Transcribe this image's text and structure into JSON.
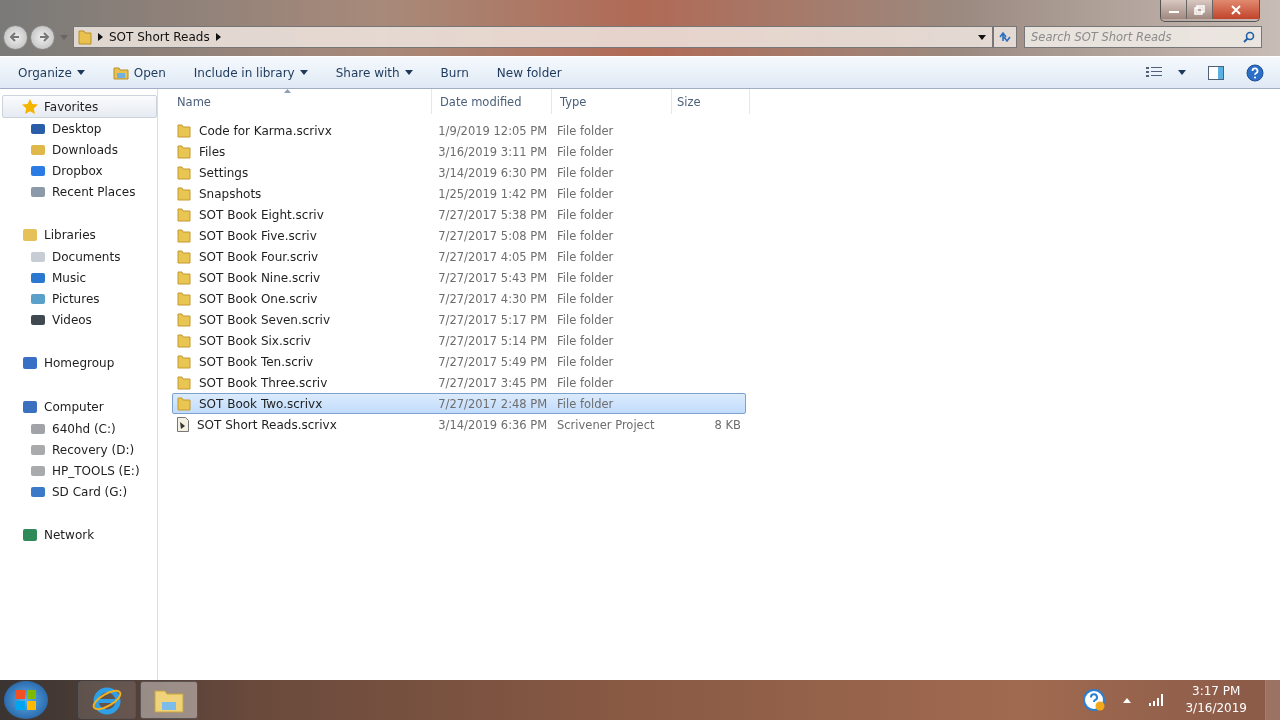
{
  "address": {
    "crumbs": [
      "SOT Short Reads"
    ]
  },
  "search": {
    "placeholder": "Search SOT Short Reads"
  },
  "toolbar": [
    {
      "label": "Organize",
      "dropdown": true,
      "icon": false
    },
    {
      "label": "Open",
      "dropdown": false,
      "icon": true
    },
    {
      "label": "Include in library",
      "dropdown": true,
      "icon": false
    },
    {
      "label": "Share with",
      "dropdown": true,
      "icon": false
    },
    {
      "label": "Burn",
      "dropdown": false,
      "icon": false
    },
    {
      "label": "New folder",
      "dropdown": false,
      "icon": false
    }
  ],
  "sidebar": {
    "groups": [
      {
        "label": "Favorites",
        "kind": "star",
        "selected": true,
        "children": [
          {
            "label": "Desktop",
            "kind": "desktop"
          },
          {
            "label": "Downloads",
            "kind": "downloads"
          },
          {
            "label": "Dropbox",
            "kind": "dropbox"
          },
          {
            "label": "Recent Places",
            "kind": "recent"
          }
        ]
      },
      {
        "label": "Libraries",
        "kind": "library",
        "selected": false,
        "children": [
          {
            "label": "Documents",
            "kind": "document"
          },
          {
            "label": "Music",
            "kind": "music"
          },
          {
            "label": "Pictures",
            "kind": "picture"
          },
          {
            "label": "Videos",
            "kind": "video"
          }
        ]
      },
      {
        "label": "Homegroup",
        "kind": "homegroup",
        "selected": false
      },
      {
        "label": "Computer",
        "kind": "computer",
        "selected": false,
        "children": [
          {
            "label": "640hd (C:)",
            "kind": "system-drive"
          },
          {
            "label": "Recovery (D:)",
            "kind": "drive"
          },
          {
            "label": "HP_TOOLS (E:)",
            "kind": "drive"
          },
          {
            "label": "SD Card (G:)",
            "kind": "sd"
          }
        ]
      },
      {
        "label": "Network",
        "kind": "network",
        "selected": false
      }
    ]
  },
  "table": {
    "columns": [
      "Name",
      "Date modified",
      "Type",
      "Size"
    ],
    "rows": [
      {
        "name": "Code for Karma.scrivx",
        "date": "1/9/2019 12:05 PM",
        "type": "File folder",
        "kind": "folder",
        "selected": false
      },
      {
        "name": "Files",
        "date": "3/16/2019 3:11 PM",
        "type": "File folder",
        "kind": "folder",
        "selected": false
      },
      {
        "name": "Settings",
        "date": "3/14/2019 6:30 PM",
        "type": "File folder",
        "kind": "folder",
        "selected": false
      },
      {
        "name": "Snapshots",
        "date": "1/25/2019 1:42 PM",
        "type": "File folder",
        "kind": "folder",
        "selected": false
      },
      {
        "name": "SOT Book Eight.scriv",
        "date": "7/27/2017 5:38 PM",
        "type": "File folder",
        "kind": "folder",
        "selected": false
      },
      {
        "name": "SOT Book Five.scriv",
        "date": "7/27/2017 5:08 PM",
        "type": "File folder",
        "kind": "folder",
        "selected": false
      },
      {
        "name": "SOT Book Four.scriv",
        "date": "7/27/2017 4:05 PM",
        "type": "File folder",
        "kind": "folder",
        "selected": false
      },
      {
        "name": "SOT Book Nine.scriv",
        "date": "7/27/2017 5:43 PM",
        "type": "File folder",
        "kind": "folder",
        "selected": false
      },
      {
        "name": "SOT Book One.scriv",
        "date": "7/27/2017 4:30 PM",
        "type": "File folder",
        "kind": "folder",
        "selected": false
      },
      {
        "name": "SOT Book Seven.scriv",
        "date": "7/27/2017 5:17 PM",
        "type": "File folder",
        "kind": "folder",
        "selected": false
      },
      {
        "name": "SOT Book Six.scriv",
        "date": "7/27/2017 5:14 PM",
        "type": "File folder",
        "kind": "folder",
        "selected": false
      },
      {
        "name": "SOT Book Ten.scriv",
        "date": "7/27/2017 5:49 PM",
        "type": "File folder",
        "kind": "folder",
        "selected": false
      },
      {
        "name": "SOT Book Three.scriv",
        "date": "7/27/2017 3:45 PM",
        "type": "File folder",
        "kind": "folder",
        "selected": false
      },
      {
        "name": "SOT Book Two.scrivx",
        "date": "7/27/2017 2:48 PM",
        "type": "File folder",
        "kind": "folder",
        "selected": true
      },
      {
        "name": "SOT Short Reads.scrivx",
        "date": "3/14/2019 6:36 PM",
        "type": "Scrivener Project",
        "size": "8 KB",
        "kind": "project",
        "selected": false
      }
    ]
  },
  "clock": {
    "time": "3:17 PM",
    "date": "3/16/2019"
  }
}
